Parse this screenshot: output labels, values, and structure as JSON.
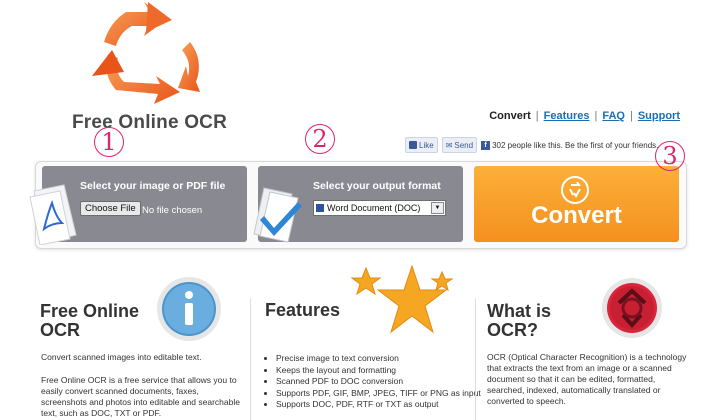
{
  "header": {
    "site_title": "Free Online OCR",
    "nav": [
      {
        "label": "Convert",
        "current": true
      },
      {
        "label": "Features",
        "current": false
      },
      {
        "label": "FAQ",
        "current": false
      },
      {
        "label": "Support",
        "current": false
      }
    ],
    "nav_separator": "|"
  },
  "social": {
    "like_label": "Like",
    "send_label": "Send",
    "like_text": "302 people like this. Be the first of your friends."
  },
  "steps": [
    "1",
    "2",
    "3"
  ],
  "panels": {
    "input": {
      "title": "Select your image or PDF file",
      "button_label": "Choose File",
      "file_status": "No file chosen"
    },
    "output": {
      "title": "Select your output format",
      "selected_format": "Word Document (DOC)"
    },
    "convert": {
      "label": "Convert"
    }
  },
  "columns": {
    "about": {
      "title": "Free Online OCR",
      "lead": "Convert scanned images into editable text.",
      "body": "Free Online OCR is a free service that allows you to easily convert scanned documents, faxes, screenshots and photos into editable and searchable text, such as DOC, TXT or PDF."
    },
    "features": {
      "title": "Features",
      "items": [
        "Precise image to text conversion",
        "Keeps the layout and formatting",
        "Scanned PDF to DOC conversion",
        "Supports PDF, GIF, BMP, JPEG, TIFF or PNG as input",
        "Supports DOC, PDF, RTF or TXT as output"
      ]
    },
    "what": {
      "title": "What is OCR?",
      "body": "OCR (Optical Character Recognition) is a technology that extracts the text from an image or a scanned document so that it can be edited, formatted, searched, indexed, automatically translated or converted to speech."
    }
  },
  "colors": {
    "accent_orange": "#f5901e",
    "panel_gray": "#898a91",
    "step_pink": "#e0246a",
    "link_blue": "#1a6fb4"
  }
}
